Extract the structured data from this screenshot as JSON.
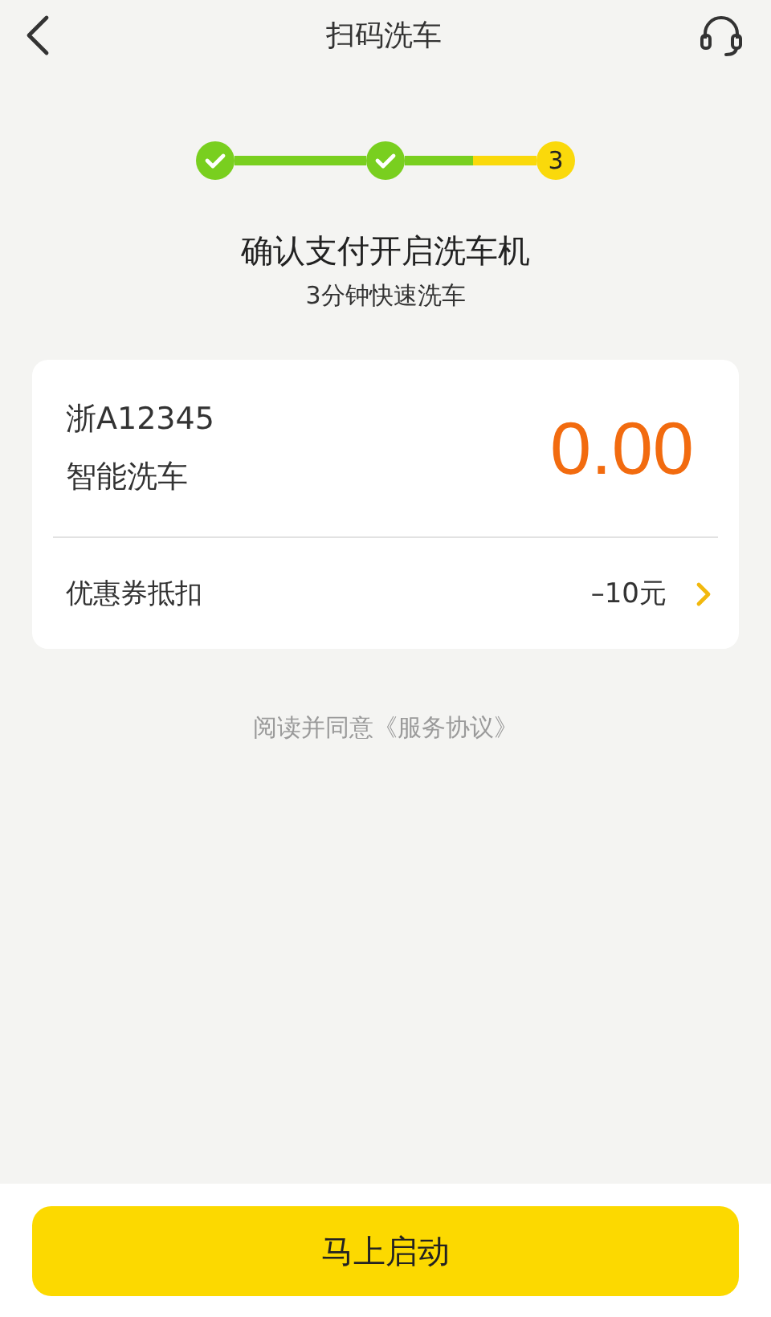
{
  "header": {
    "title": "扫码洗车"
  },
  "stepper": {
    "steps": [
      {
        "kind": "done"
      },
      {
        "kind": "done"
      },
      {
        "kind": "current",
        "label": "3"
      }
    ]
  },
  "heading": {
    "title": "确认支付开启洗车机",
    "subtitle": "3分钟快速洗车"
  },
  "order": {
    "plate": "浙A12345",
    "service": "智能洗车",
    "price": "0.00",
    "coupon": {
      "label": "优惠券抵扣",
      "value": "–10元"
    }
  },
  "agreement": "阅读并同意《服务协议》",
  "action": {
    "label": "马上启动"
  }
}
